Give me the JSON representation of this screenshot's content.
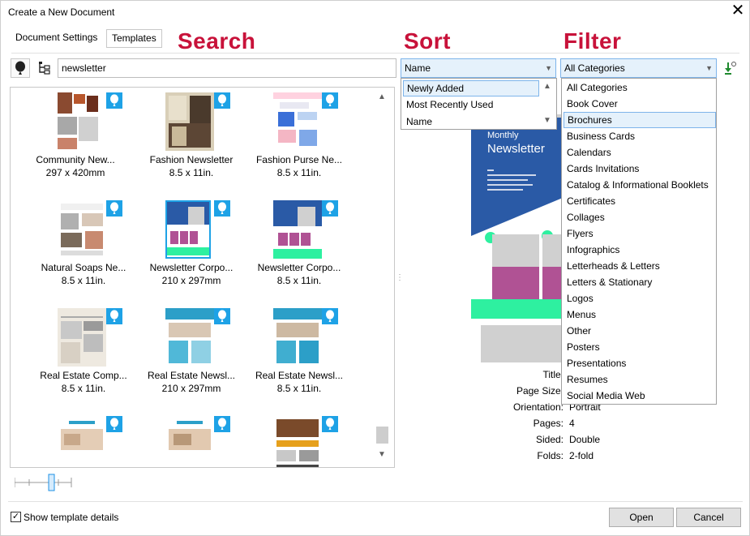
{
  "window": {
    "title": "Create a New Document"
  },
  "tabs": [
    {
      "label": "Document Settings",
      "active": false
    },
    {
      "label": "Templates",
      "active": true
    }
  ],
  "annotations": {
    "search": "Search",
    "sort": "Sort",
    "filter": "Filter"
  },
  "search": {
    "value": "newsletter"
  },
  "sort": {
    "selected": "Name",
    "options": [
      "Newly Added",
      "Most Recently Used",
      "Name"
    ],
    "highlighted": "Newly Added"
  },
  "filter": {
    "selected": "All Categories",
    "options": [
      "All Categories",
      "Book Cover",
      "Brochures",
      "Business Cards",
      "Calendars",
      "Cards Invitations",
      "Catalog & Informational Booklets",
      "Certificates",
      "Collages",
      "Flyers",
      "Infographics",
      "Letterheads & Letters",
      "Letters & Stationary",
      "Logos",
      "Menus",
      "Other",
      "Posters",
      "Presentations",
      "Resumes",
      "Social Media Web"
    ],
    "highlighted": "Brochures"
  },
  "templates": [
    {
      "name": "Community New...",
      "size": "297 x 420mm"
    },
    {
      "name": "Fashion Newsletter",
      "size": "8.5 x 11in."
    },
    {
      "name": "Fashion Purse Ne...",
      "size": "8.5 x 11in."
    },
    {
      "name": "Natural Soaps Ne...",
      "size": "8.5 x 11in."
    },
    {
      "name": "Newsletter Corpo...",
      "size": "210 x 297mm",
      "selected": true
    },
    {
      "name": "Newsletter Corpo...",
      "size": "8.5 x 11in."
    },
    {
      "name": "Real Estate Comp...",
      "size": "8.5 x 11in."
    },
    {
      "name": "Real Estate Newsl...",
      "size": "210 x 297mm"
    },
    {
      "name": "Real Estate Newsl...",
      "size": "8.5 x 11in."
    },
    {
      "name": "",
      "size": ""
    },
    {
      "name": "",
      "size": ""
    },
    {
      "name": "",
      "size": ""
    }
  ],
  "preview": {
    "heading_small": "Monthly",
    "heading_big": "Newsletter"
  },
  "details": [
    {
      "key": "Title:",
      "value": ""
    },
    {
      "key": "Page Size:",
      "value": ""
    },
    {
      "key": "Orientation:",
      "value": "Portrait"
    },
    {
      "key": "Pages:",
      "value": "4"
    },
    {
      "key": "Sided:",
      "value": "Double"
    },
    {
      "key": "Folds:",
      "value": "2-fold"
    }
  ],
  "footer": {
    "show_details_label": "Show template details",
    "show_details_checked": true,
    "open_label": "Open",
    "cancel_label": "Cancel"
  },
  "colors": {
    "accent": "#c8123a",
    "badge": "#1ea2e6",
    "highlight": "#e5f1fb",
    "highlight_border": "#7eb4ea"
  },
  "icons": {
    "badge": "balloon-icon",
    "close": "close-icon"
  }
}
